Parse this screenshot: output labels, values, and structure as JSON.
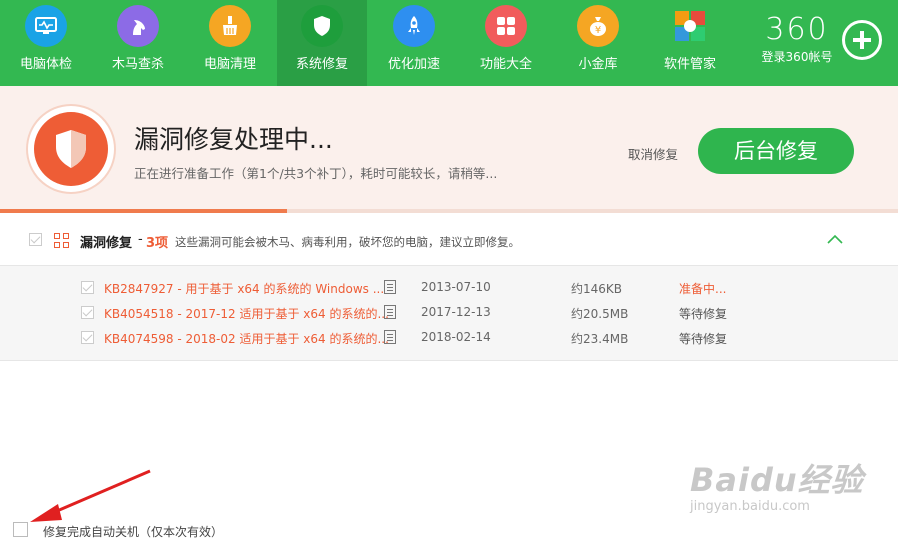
{
  "nav": {
    "items": [
      {
        "label": "电脑体检",
        "icon": "monitor-icon",
        "color": "#1aa3e6"
      },
      {
        "label": "木马查杀",
        "icon": "horse-icon",
        "color": "#8c6be6"
      },
      {
        "label": "电脑清理",
        "icon": "broom-icon",
        "color": "#f5a623"
      },
      {
        "label": "系统修复",
        "icon": "shield-icon",
        "color": "#1e9e3c"
      },
      {
        "label": "优化加速",
        "icon": "rocket-icon",
        "color": "#2e8ff0"
      },
      {
        "label": "功能大全",
        "icon": "grid-icon",
        "color": "#f15c5c"
      },
      {
        "label": "小金库",
        "icon": "money-bag-icon",
        "color": "#f5a623"
      },
      {
        "label": "软件管家",
        "icon": "apps-icon",
        "color": "#ffffff"
      }
    ],
    "active_index": 3
  },
  "brand": {
    "logo": "360",
    "login": "登录360帐号"
  },
  "status": {
    "title": "漏洞修复处理中...",
    "subtitle": "正在进行准备工作（第1个/共3个补丁），耗时可能较长，请稍等...",
    "cancel": "取消修复",
    "background_button": "后台修复",
    "progress": 0.32
  },
  "section": {
    "title": "漏洞修复",
    "dash": "-",
    "count": "3项",
    "description": "这些漏洞可能会被木马、病毒利用，破坏您的电脑，建议立即修复。"
  },
  "patches": [
    {
      "name": "KB2847927 - 用于基于 x64 的系统的 Windows ...",
      "date": "2013-07-10",
      "size": "约146KB",
      "status": "准备中..."
    },
    {
      "name": "KB4054518 - 2017-12 适用于基于 x64 的系统的...",
      "date": "2017-12-13",
      "size": "约20.5MB",
      "status": "等待修复"
    },
    {
      "name": "KB4074598 - 2018-02 适用于基于 x64 的系统的...",
      "date": "2018-02-14",
      "size": "约23.4MB",
      "status": "等待修复"
    }
  ],
  "footer": {
    "shutdown_label": "修复完成自动关机（仅本次有效）"
  },
  "watermark": {
    "main": "Baidu经验",
    "sub": "jingyan.baidu.com"
  },
  "colors": {
    "green": "#33b851",
    "accent": "#ee5d36"
  }
}
